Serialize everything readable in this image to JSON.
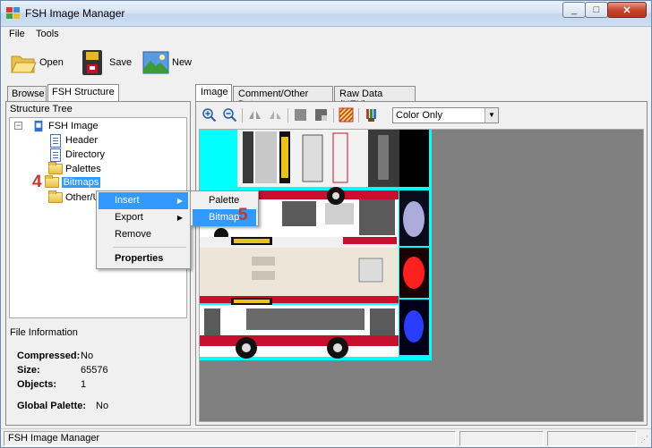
{
  "window": {
    "title": "FSH Image Manager"
  },
  "menu": {
    "file": "File",
    "tools": "Tools"
  },
  "toolbar": {
    "open": "Open",
    "save": "Save",
    "new": "New"
  },
  "left_tabs": {
    "browse": "Browse",
    "structure": "FSH Structure"
  },
  "tree": {
    "label": "Structure Tree",
    "root": "FSH Image",
    "expander": "−",
    "items": [
      {
        "label": "Header",
        "icon": "document-icon"
      },
      {
        "label": "Directory",
        "icon": "document-icon"
      },
      {
        "label": "Palettes",
        "icon": "folder-icon"
      },
      {
        "label": "Bitmaps",
        "icon": "folder-icon"
      },
      {
        "label": "Other/U",
        "icon": "folder-icon"
      }
    ],
    "step_marker": "4"
  },
  "file_info": {
    "title": "File Information",
    "compressed_label": "Compressed:",
    "compressed_value": "No",
    "size_label": "Size:",
    "size_value": "65576",
    "objects_label": "Objects:",
    "objects_value": "1",
    "global_palette_label": "Global Palette:",
    "global_palette_value": "No"
  },
  "right_tabs": {
    "image": "Image",
    "comment": "Comment/Other Data",
    "raw": "Raw Data (HEX)"
  },
  "image_toolbar": {
    "view_mode": "Color Only"
  },
  "context_menu": {
    "insert": "Insert",
    "export": "Export",
    "remove": "Remove",
    "properties": "Properties"
  },
  "submenu": {
    "palette": "Palette",
    "bitmap": "Bitmap",
    "step_marker": "5"
  },
  "status": {
    "text": "FSH Image Manager"
  },
  "colors": {
    "selection": "#3399ff",
    "canvas_bg": "#808080",
    "texture_alpha": "#00ffff",
    "bus_red": "#c8102e"
  }
}
